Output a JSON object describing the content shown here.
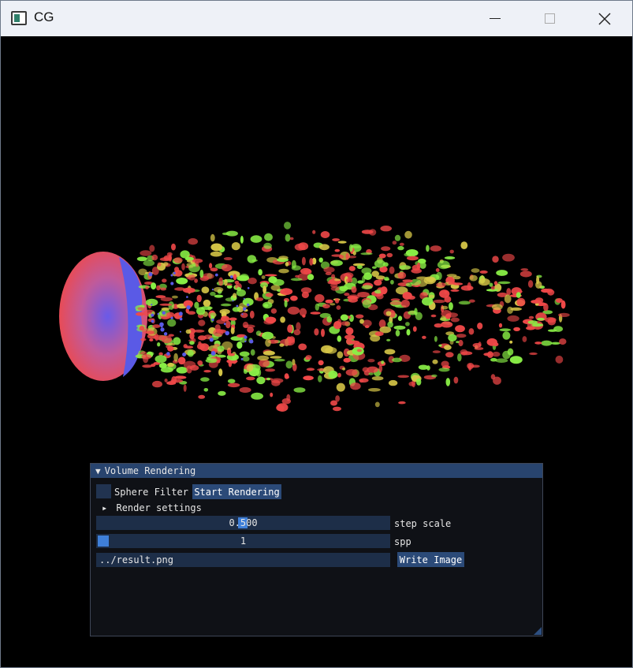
{
  "window": {
    "title": "CG",
    "controls": {
      "minimize": "minimize",
      "maximize": "maximize",
      "close": "✕"
    }
  },
  "panel": {
    "title": "Volume Rendering",
    "collapse_arrow": "▼",
    "sphere_filter_label": "Sphere Filter",
    "sphere_filter_checked": false,
    "start_button": "Start Rendering",
    "render_settings": {
      "arrow": "▸",
      "label": "Render settings"
    },
    "step_scale": {
      "value": "0.500",
      "label": "step scale"
    },
    "spp": {
      "value": "1",
      "label": "spp"
    },
    "output_path": "../result.png",
    "write_button": "Write Image"
  },
  "colors": {
    "panel_header": "#28446e",
    "panel_bg": "#0f1116",
    "frame_bg": "#1d2e48",
    "button": "#2b4a78",
    "slider_grab": "#3f7fd8",
    "render_red": "#f04848",
    "render_green": "#8af046",
    "render_yellow": "#d8c848",
    "render_blue": "#5a5ae6"
  }
}
